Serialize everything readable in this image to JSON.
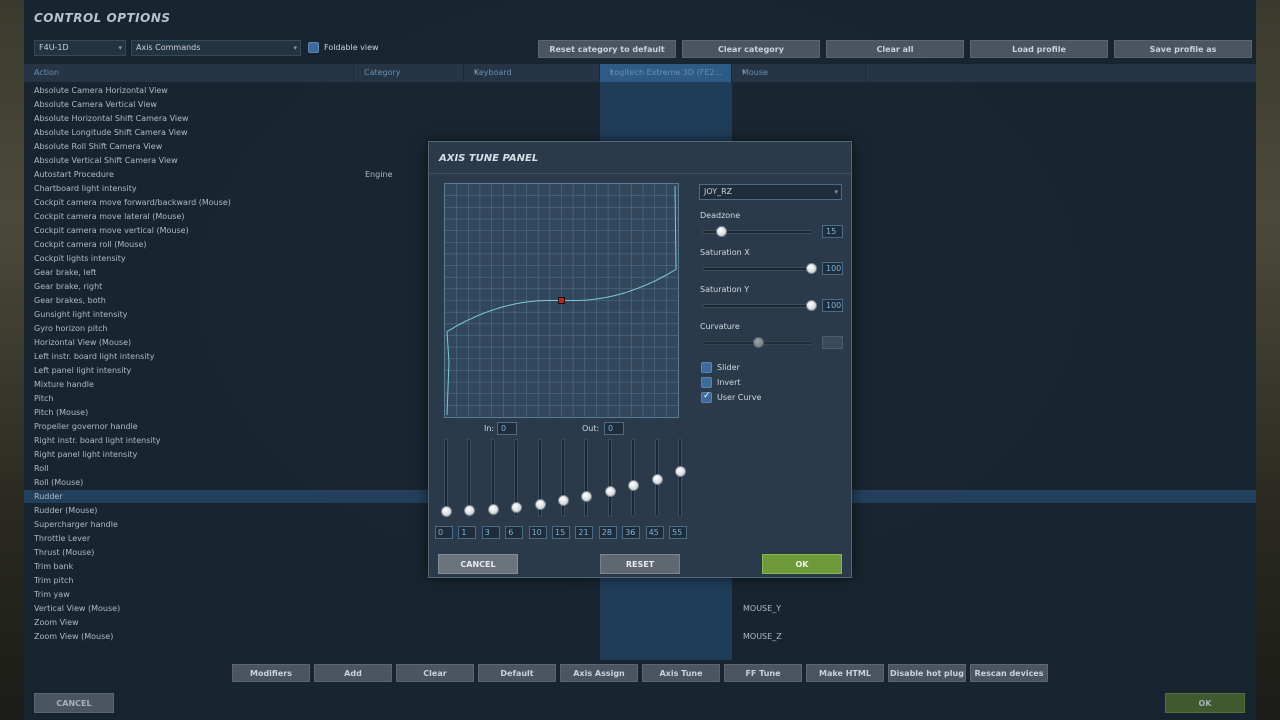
{
  "window": {
    "title": "CONTROL OPTIONS"
  },
  "toolbar": {
    "aircraft": "F4U-1D",
    "category": "Axis Commands",
    "foldable_label": "Foldable view",
    "buttons": [
      "Reset category to default",
      "Clear category",
      "Clear all",
      "Load profile",
      "Save profile as"
    ]
  },
  "columns": {
    "action": "Action",
    "category": "Category",
    "keyboard": "Keyboard",
    "joystick": "Logitech Extreme 3D (FE2...",
    "mouse": "Mouse"
  },
  "actions": [
    "Absolute Camera Horizontal View",
    "Absolute Camera Vertical View",
    "Absolute Horizontal Shift Camera View",
    "Absolute Longitude Shift Camera View",
    "Absolute Roll Shift Camera View",
    "Absolute Vertical Shift Camera View",
    "Autostart Procedure",
    "Chartboard light intensity",
    "Cockpit camera move forward/backward (Mouse)",
    "Cockpit camera move lateral (Mouse)",
    "Cockpit camera move vertical (Mouse)",
    "Cockpit camera roll (Mouse)",
    "Cockpit lights intensity",
    "Gear brake, left",
    "Gear brake, right",
    "Gear brakes, both",
    "Gunsight light intensity",
    "Gyro horizon pitch",
    "Horizontal View (Mouse)",
    "Left instr. board light intensity",
    "Left panel light intensity",
    "Mixture handle",
    "Pitch",
    "Pitch (Mouse)",
    "Propeller governor handle",
    "Right instr. board light intensity",
    "Right panel light intensity",
    "Roll",
    "Roll (Mouse)",
    "Rudder",
    "Rudder (Mouse)",
    "Supercharger handle",
    "Throttle Lever",
    "Thrust (Mouse)",
    "Trim bank",
    "Trim pitch",
    "Trim yaw",
    "Vertical View (Mouse)",
    "Zoom View",
    "Zoom View (Mouse)"
  ],
  "cells": {
    "autostart_category": "Engine",
    "vertical_view_mouse": "MOUSE_Y",
    "zoom_view_mouse": "MOUSE_Z"
  },
  "bottom_buttons": [
    "Modifiers",
    "Add",
    "Clear",
    "Default",
    "Axis Assign",
    "Axis Tune",
    "FF Tune",
    "Make HTML",
    "Disable hot plug",
    "Rescan devices"
  ],
  "footer": {
    "cancel": "CANCEL",
    "ok": "OK"
  },
  "dialog": {
    "title": "AXIS TUNE PANEL",
    "axis": "JOY_RZ",
    "deadzone_label": "Deadzone",
    "deadzone": "15",
    "saturation_x_label": "Saturation X",
    "saturation_x": "100",
    "saturation_y_label": "Saturation Y",
    "saturation_y": "100",
    "curvature_label": "Curvature",
    "curvature": "",
    "slider_label": "Slider",
    "invert_label": "Invert",
    "user_curve_label": "User Curve",
    "slider_checked": false,
    "invert_checked": false,
    "user_curve_checked": true,
    "in_label": "In:",
    "in_value": "0",
    "out_label": "Out:",
    "out_value": "0",
    "curve_points": [
      "0",
      "1",
      "3",
      "6",
      "10",
      "15",
      "21",
      "28",
      "36",
      "45",
      "55"
    ],
    "cancel": "CANCEL",
    "reset": "RESET",
    "ok": "OK"
  },
  "colors": {
    "ok_green": "#6f9a3a",
    "button_gray": "#4a5561",
    "highlight": "#2c5680",
    "curve": "#7ec8d8"
  }
}
